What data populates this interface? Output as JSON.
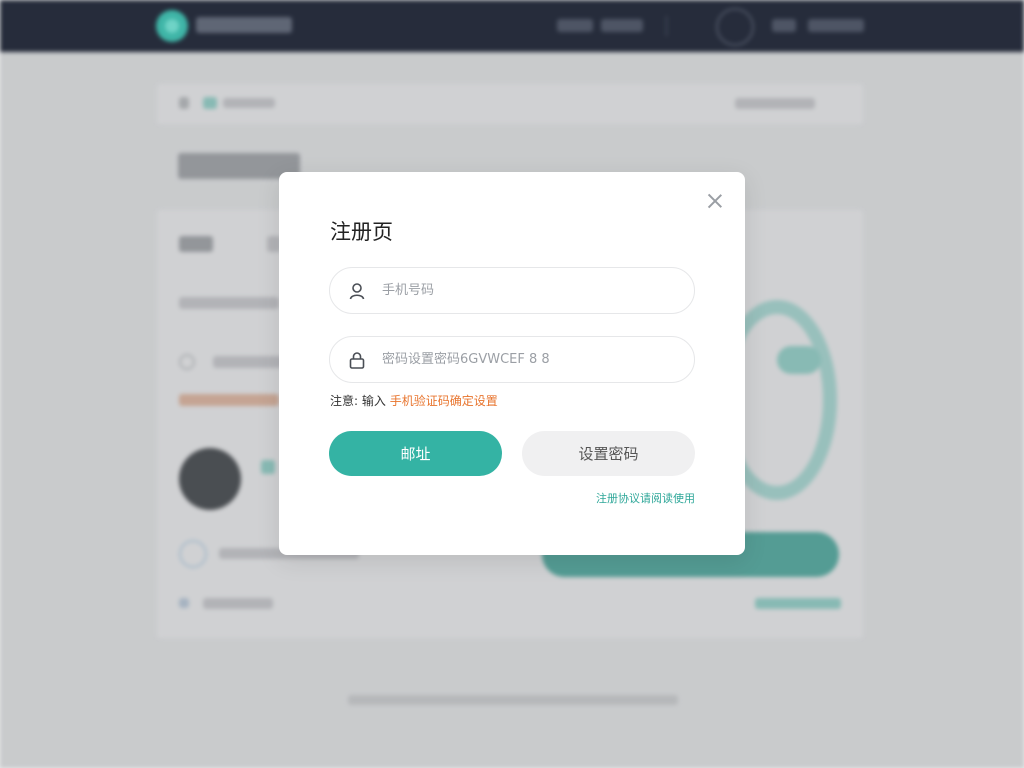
{
  "modal": {
    "title": "注册页",
    "phone_placeholder": "手机号码",
    "password_placeholder": "密码设置密码6GVWCEF 8 8",
    "note_prefix": "注意: 输入",
    "note_highlight": "手机验证码确定设置",
    "primary_button": "邮址",
    "secondary_button": "设置密码",
    "link_text": "注册协议请阅读使用"
  },
  "icons": {
    "close": "close-icon",
    "user": "user-icon",
    "lock": "lock-icon",
    "logo": "logo-icon"
  },
  "colors": {
    "accent": "#34b3a4",
    "header_bg": "#262c3b",
    "highlight": "#e8742d",
    "link": "#2ea799"
  }
}
